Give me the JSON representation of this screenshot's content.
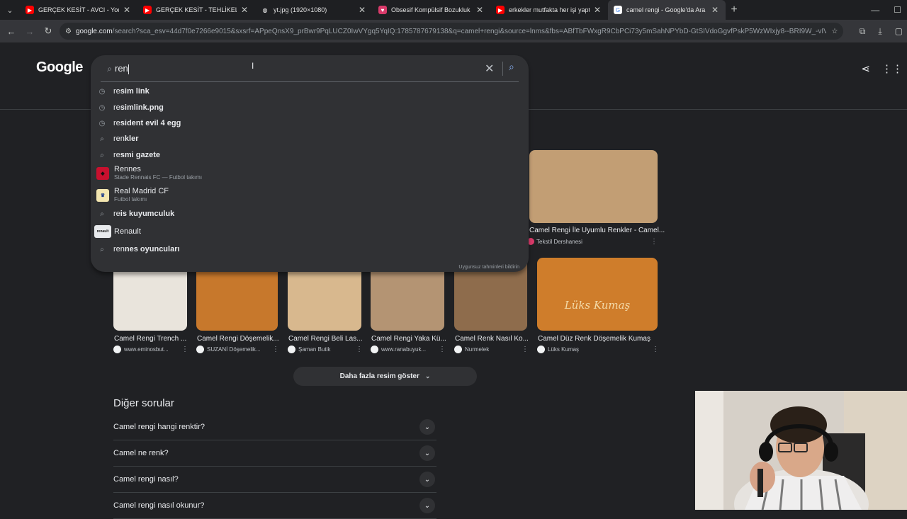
{
  "tabs": [
    {
      "title": "GERÇEK KESİT - AVCI - YouTube",
      "favicon": "youtube-icon",
      "color": "#ff0000"
    },
    {
      "title": "GERÇEK KESİT - TEHLİKELİ OYUN",
      "favicon": "youtube-icon",
      "color": "#ff0000"
    },
    {
      "title": "yt.jpg (1920×1080)",
      "favicon": "globe-icon",
      "color": "#9aa0a6"
    },
    {
      "title": "Obsesif Kompülsif Bozukluk Tes",
      "favicon": "heart-icon",
      "color": "#d93a6a"
    },
    {
      "title": "erkekler mutfakta her işi yaptık",
      "favicon": "youtube-icon",
      "color": "#ff0000"
    },
    {
      "title": "camel rengi - Google'da Ara",
      "favicon": "google-icon",
      "color": "#4285f4"
    }
  ],
  "address": {
    "host": "google.com",
    "path": "/search?sca_esv=44d7f0e7266e9015&sxsrf=APpeQnsX9_prBwr9PqLUCZ0IwVYgq5YqIQ:1785787679138&q=camel+rengi&source=lnms&fbs=ABfTbFWxgR9CbPCi73y5mSahNPYbD-GtSIVdoGgvfPskP5WzWIxjy8--BRI9W_-vIVWMsIGJx..."
  },
  "logo": "Google",
  "search": {
    "value": "ren",
    "report": "Uygunsuz tahminleri bildirin",
    "suggestions": [
      {
        "pre": "re",
        "rest": "sim link",
        "icon": "history-icon"
      },
      {
        "pre": "re",
        "rest": "simlink.png",
        "icon": "history-icon"
      },
      {
        "pre": "re",
        "rest": "sident evil 4 egg",
        "icon": "history-icon"
      },
      {
        "pre": "ren",
        "rest": "kler",
        "icon": "search-icon"
      },
      {
        "pre": "re",
        "rest": "smi gazete",
        "icon": "search-icon"
      },
      {
        "title": "Rennes",
        "sub": "Stade Rennais FC — Futbol takımı",
        "icon": "rennes-logo"
      },
      {
        "title": "Real Madrid CF",
        "sub": "Futbol takımı",
        "icon": "realmadrid-logo"
      },
      {
        "pre": "re",
        "rest": "is kuyumculuk",
        "icon": "search-icon"
      },
      {
        "title": "Renault",
        "icon": "renault-logo"
      },
      {
        "pre": "ren",
        "rest": "nes oyuncuları",
        "icon": "search-icon"
      }
    ]
  },
  "top_result": {
    "caption": "Camel Rengi İle Uyumlu Renkler - Camel...",
    "source": "Tekstil Dershanesi",
    "color": "#c29e74"
  },
  "images": [
    {
      "caption": "Camel Rengi Trench ...",
      "source": "www.eminosbut...",
      "color": "#e9e4dc"
    },
    {
      "caption": "Camel Rengi Döşemelik...",
      "source": "SUZANİ Döşemelik...",
      "color": "#c7782c"
    },
    {
      "caption": "Camel Rengi Beli Las...",
      "source": "Şaman Butik",
      "color": "#d8b88e"
    },
    {
      "caption": "Camel Rengi Yaka Kü...",
      "source": "www.ranabuyuk...",
      "color": "#b49473"
    },
    {
      "caption": "Camel Renk Nasıl Ko...",
      "source": "Nurmelek",
      "color": "#8e6c4c"
    },
    {
      "caption": "Camel Düz Renk Döşemelik Kumaş",
      "source": "Lüks Kumaş",
      "color": "#cf7d2b",
      "overlay": "Lüks Kumaş"
    }
  ],
  "more_button": "Daha fazla resim göster",
  "paa": {
    "title": "Diğer sorular",
    "questions": [
      "Camel rengi hangi renktir?",
      "Camel ne renk?",
      "Camel rengi nasıl?",
      "Camel rengi nasıl okunur?"
    ]
  }
}
